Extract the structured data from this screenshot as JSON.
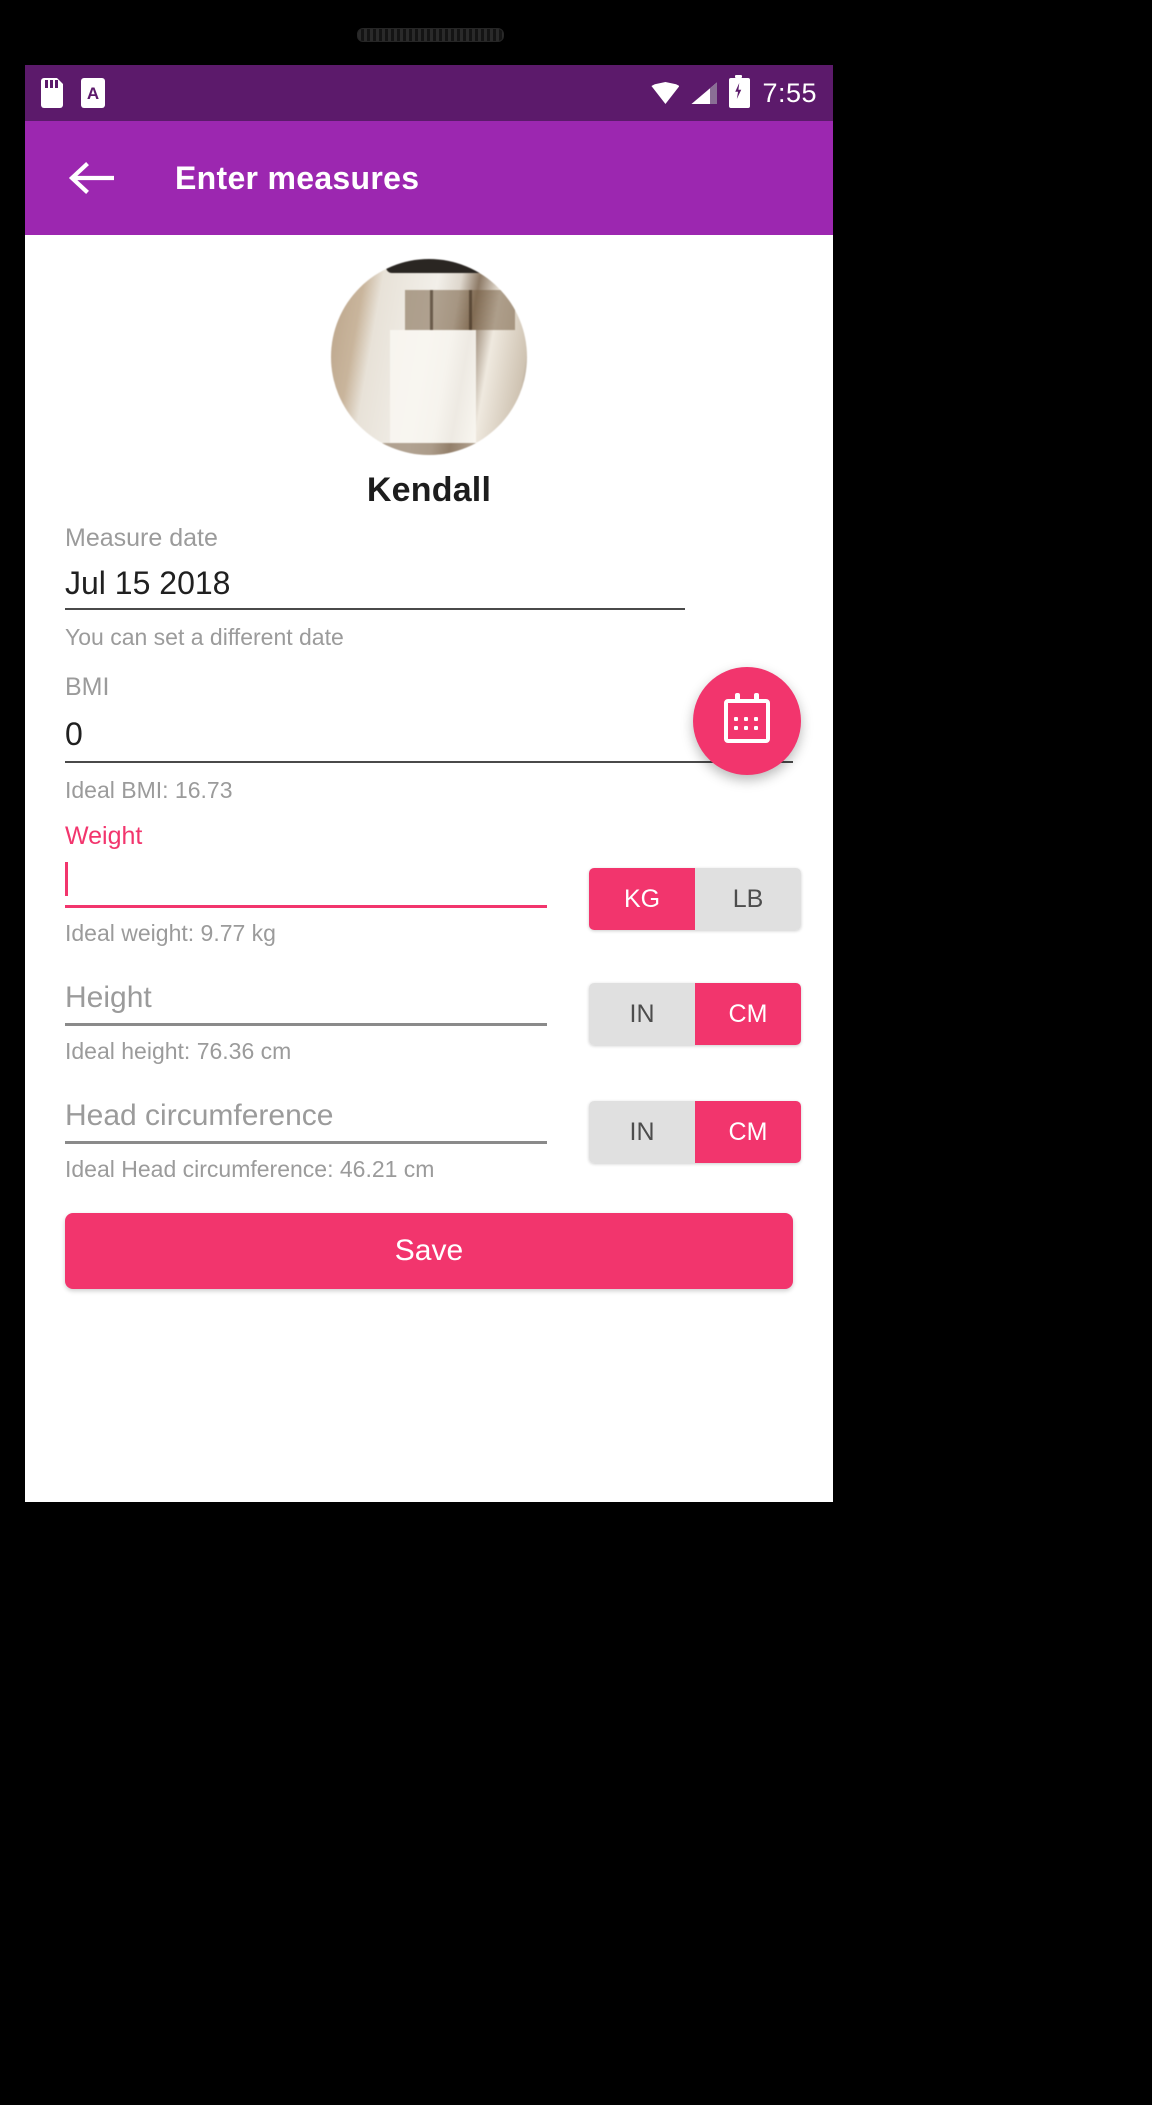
{
  "statusbar": {
    "time": "7:55",
    "icons": [
      "sd-card-icon",
      "font-size-icon",
      "wifi-icon",
      "cellular-signal-icon",
      "battery-charging-icon"
    ]
  },
  "appbar": {
    "back_label": "back-arrow",
    "title": "Enter measures",
    "bg": "#9c27b0"
  },
  "profile": {
    "name": "Kendall"
  },
  "form": {
    "measure_date": {
      "label": "Measure date",
      "value": "Jul 15 2018",
      "hint": "You can set a different date"
    },
    "bmi": {
      "label": "BMI",
      "value": "0",
      "hint": "Ideal BMI: 16.73"
    },
    "weight": {
      "label": "Weight",
      "value": "",
      "placeholder": "Weight",
      "hint": "Ideal weight: 9.77 kg",
      "units": {
        "left": "KG",
        "right": "LB",
        "selected": "KG"
      }
    },
    "height": {
      "label": "Height",
      "value": "",
      "placeholder": "Height",
      "hint": "Ideal height: 76.36 cm",
      "units": {
        "left": "IN",
        "right": "CM",
        "selected": "CM"
      }
    },
    "head": {
      "label": "Head circumference",
      "value": "",
      "placeholder": "Head circumference",
      "hint": "Ideal Head circumference: 46.21 cm",
      "units": {
        "left": "IN",
        "right": "CM",
        "selected": "CM"
      }
    },
    "save_label": "Save",
    "fab": "calendar-icon"
  },
  "navbar": {
    "back": "nav-back-icon",
    "home": "nav-home-icon",
    "recents": "nav-recents-icon"
  },
  "colors": {
    "accent_pink": "#f2356d",
    "appbar_purple": "#9c27b0",
    "statusbar_purple": "#5c1a6b",
    "navbar_purple": "#8b26ac"
  }
}
